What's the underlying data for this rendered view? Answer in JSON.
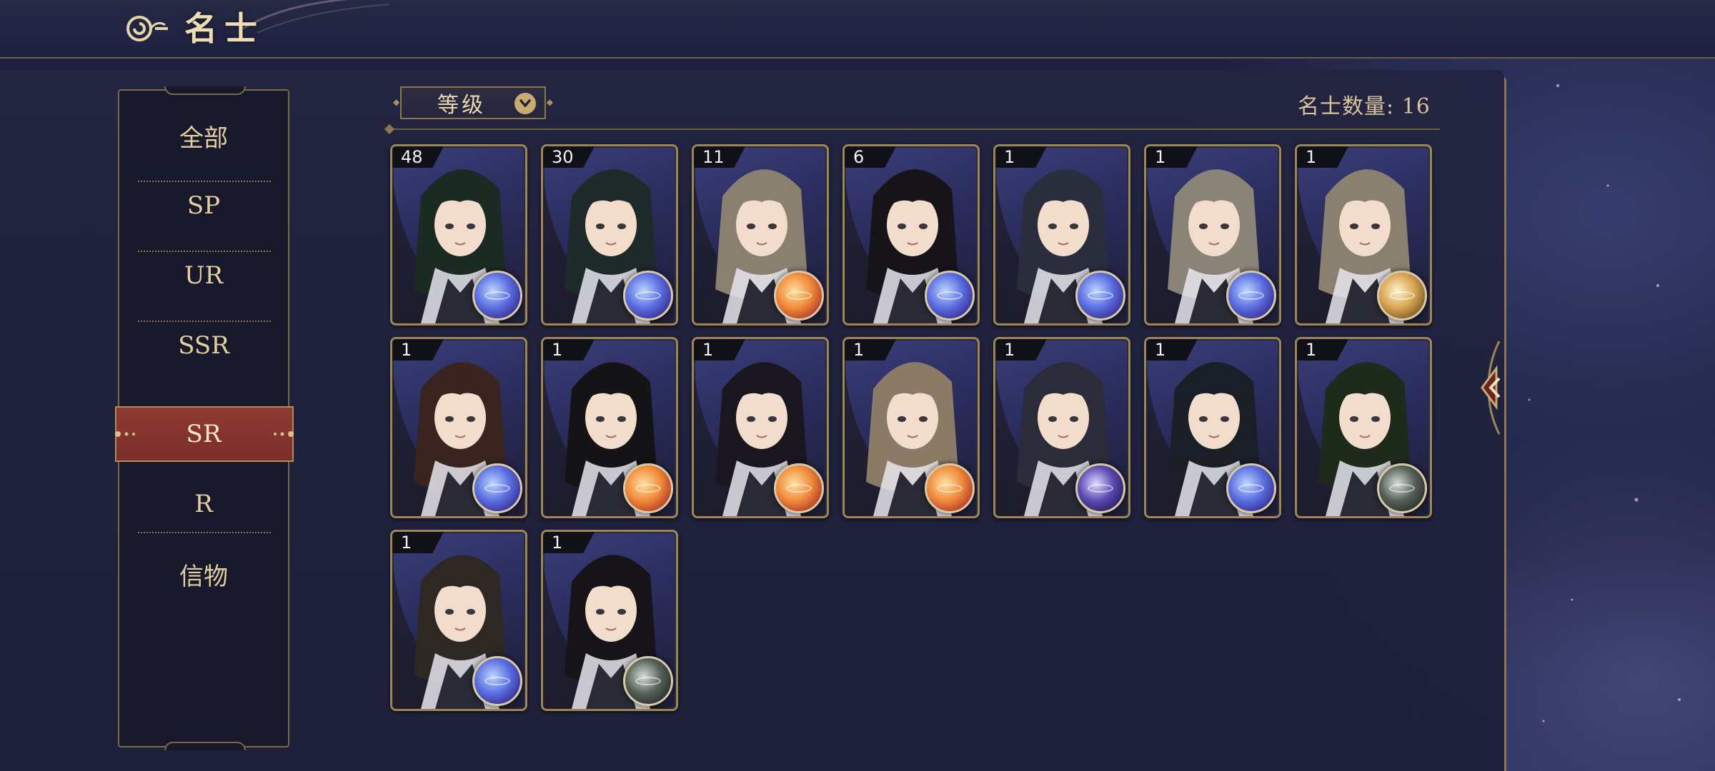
{
  "header": {
    "title": "名士",
    "back_icon": "cloud-swirl-back-icon"
  },
  "sidebar": {
    "items": [
      {
        "label": "全部",
        "active": false
      },
      {
        "label": "SP",
        "active": false
      },
      {
        "label": "UR",
        "active": false
      },
      {
        "label": "SSR",
        "active": false
      },
      {
        "label": "SR",
        "active": true
      },
      {
        "label": "R",
        "active": false
      },
      {
        "label": "信物",
        "active": false
      }
    ]
  },
  "toolbar": {
    "sort_label": "等级",
    "sort_icon": "chevron-down-icon",
    "count_label": "名士数量:",
    "count_value": "16"
  },
  "cards": [
    {
      "level": "48",
      "element": "blue",
      "hair": "#1c2a24"
    },
    {
      "level": "30",
      "element": "blue",
      "hair": "#1e2a2a"
    },
    {
      "level": "11",
      "element": "orange",
      "hair": "#8a8070"
    },
    {
      "level": "6",
      "element": "blue",
      "hair": "#161418"
    },
    {
      "level": "1",
      "element": "blue",
      "hair": "#2a2e3c"
    },
    {
      "level": "1",
      "element": "blue",
      "hair": "#8a8478"
    },
    {
      "level": "1",
      "element": "gold",
      "hair": "#8a8070"
    },
    {
      "level": "1",
      "element": "blue",
      "hair": "#3a2420"
    },
    {
      "level": "1",
      "element": "orange",
      "hair": "#141416"
    },
    {
      "level": "1",
      "element": "orange",
      "hair": "#1a1620"
    },
    {
      "level": "1",
      "element": "orange",
      "hair": "#8a7a66"
    },
    {
      "level": "1",
      "element": "purple",
      "hair": "#2a2c3a"
    },
    {
      "level": "1",
      "element": "blue",
      "hair": "#1a1e26"
    },
    {
      "level": "1",
      "element": "grey",
      "hair": "#1e2a1c"
    },
    {
      "level": "1",
      "element": "blue",
      "hair": "#2e2824"
    },
    {
      "level": "1",
      "element": "grey",
      "hair": "#161418"
    }
  ],
  "colors": {
    "accent_gold": "#c9ab72",
    "active_tab": "#8f3a33",
    "panel": "#1e2140"
  }
}
